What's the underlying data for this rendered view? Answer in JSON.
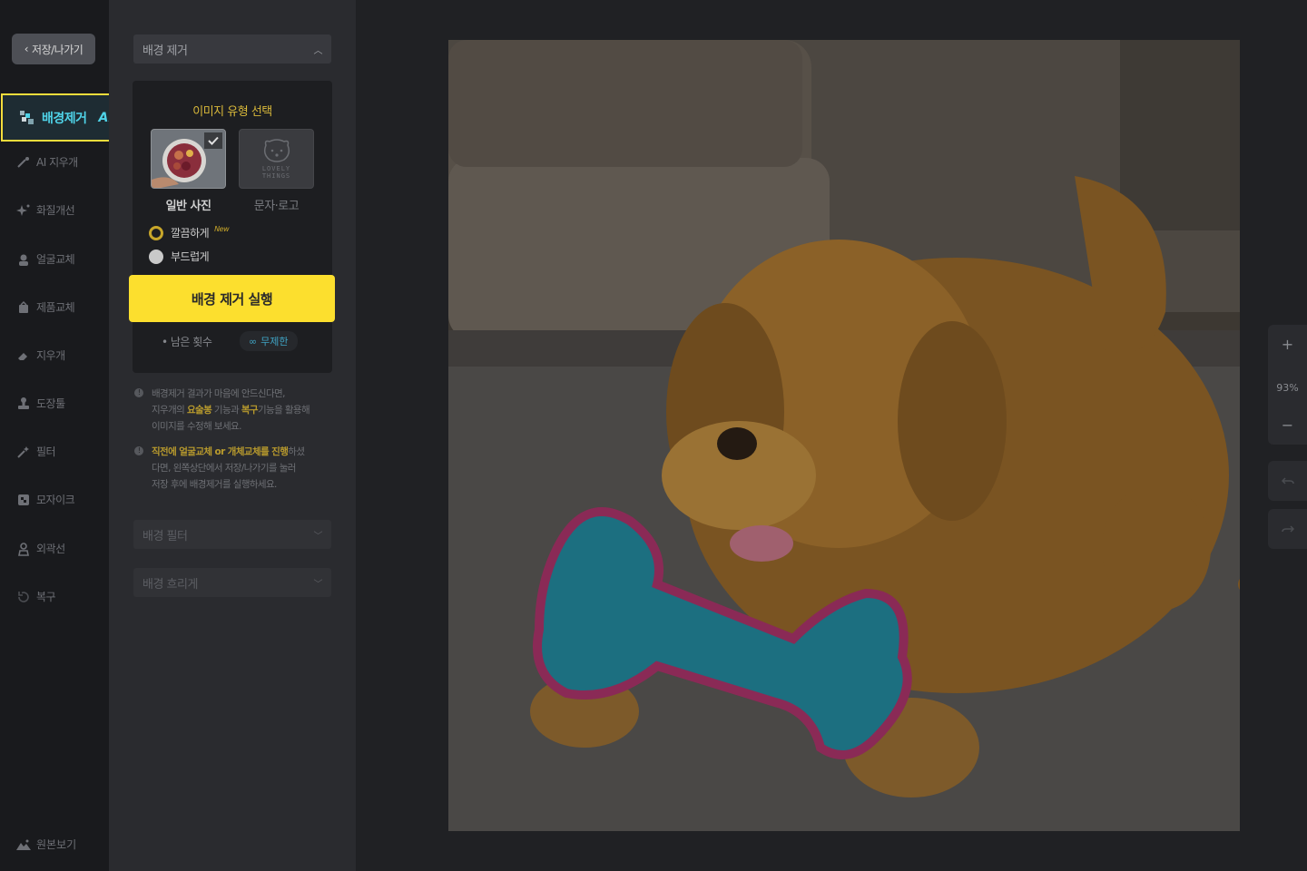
{
  "rail": {
    "back_label": "저장/나가기",
    "active_item": {
      "label": "배경제거",
      "badge": "AI."
    },
    "items": [
      {
        "label": "AI 지우개",
        "icon": "magic-eraser-icon"
      },
      {
        "label": "화질개선",
        "icon": "sparkle-icon"
      },
      {
        "label": "얼굴교체",
        "icon": "face-swap-icon"
      },
      {
        "label": "제품교체",
        "icon": "product-swap-icon"
      },
      {
        "label": "지우개",
        "icon": "eraser-icon"
      },
      {
        "label": "도장툴",
        "icon": "stamp-icon"
      },
      {
        "label": "필터",
        "icon": "filter-wand-icon"
      },
      {
        "label": "모자이크",
        "icon": "mosaic-icon"
      },
      {
        "label": "외곽선",
        "icon": "outline-person-icon"
      },
      {
        "label": "복구",
        "icon": "restore-icon"
      }
    ],
    "view_original": "원본보기"
  },
  "panel": {
    "bg_removal_header": "배경 제거",
    "image_type_title": "이미지 유형 선택",
    "types": [
      {
        "label": "일반 사진",
        "selected": true
      },
      {
        "label": "문자·로고",
        "selected": false
      }
    ],
    "logo_thumb_text": [
      "LOVELY",
      "THINGS"
    ],
    "modes": [
      {
        "label": "깔끔하게",
        "selected": true,
        "tag": "New"
      },
      {
        "label": "부드럽게",
        "selected": false
      }
    ],
    "run_button": "배경 제거 실행",
    "remaining_label": "• 남은 횟수",
    "remaining_value": "무제한",
    "note1": {
      "a": "배경제거 결과가 마음에 안드신다면,",
      "b1": "지우개의 ",
      "b2": "요술봉",
      "b3": " 기능과 ",
      "b4": "복구",
      "b5": "기능을 활용해",
      "c": "이미지를 수정해 보세요."
    },
    "note2": {
      "a1": "직전에 얼굴교체 or 개체교체를 진행",
      "a2": "하셨",
      "b": "다면, 왼쪽상단에서 저장/나가기를 눌러",
      "c": "저장 후에 배경제거를 실행하세요."
    },
    "bg_filter_header": "배경 필터",
    "bg_blur_header": "배경 흐리게"
  },
  "canvas": {
    "zoom_in": "+",
    "zoom_level": "93%",
    "zoom_out": "−"
  },
  "colors": {
    "accent_yellow": "#fcdf2e",
    "accent_cyan": "#4fd3e8",
    "highlight_gold": "#d9b93a"
  }
}
